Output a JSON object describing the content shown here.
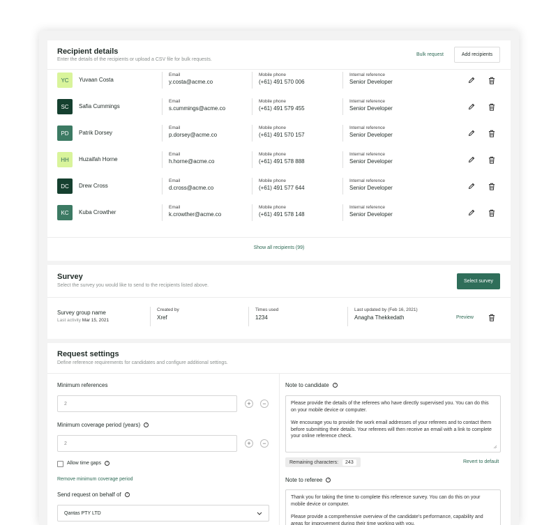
{
  "recipients": {
    "title": "Recipient details",
    "subtitle": "Enter the details of the recipients or upload a CSV file for bulk requests.",
    "bulk_request_label": "Bulk request",
    "add_recipients_label": "Add recipients",
    "email_label": "Email",
    "mobile_label": "Mobile phone",
    "reference_label": "Internal reference",
    "rows": [
      {
        "initials": "YC",
        "name": "Yuvaan Costa",
        "email": "y.costa@acme.co",
        "mobile": "(+61) 491 570 006",
        "reference": "Senior Developer",
        "avatar_color": "#d9f49b"
      },
      {
        "initials": "SC",
        "name": "Safia Cummings",
        "email": "s.cummings@acme.co",
        "mobile": "(+61) 491 579 455",
        "reference": "Senior Developer",
        "avatar_color": "#15402f"
      },
      {
        "initials": "PD",
        "name": "Patrik Dorsey",
        "email": "p.dorsey@acme.co",
        "mobile": "(+61) 491 570 157",
        "reference": "Senior Developer",
        "avatar_color": "#3c7a63"
      },
      {
        "initials": "HH",
        "name": "Huzaifah Horne",
        "email": "h.horne@acme.co",
        "mobile": "(+61) 491 578 888",
        "reference": "Senior Developer",
        "avatar_color": "#d9f49b"
      },
      {
        "initials": "DC",
        "name": "Drew Cross",
        "email": "d.cross@acme.co",
        "mobile": "(+61) 491 577 644",
        "reference": "Senior Developer",
        "avatar_color": "#15402f"
      },
      {
        "initials": "KC",
        "name": "Kuba Crowther",
        "email": "k.crowther@acme.co",
        "mobile": "(+61) 491 578 148",
        "reference": "Senior Developer",
        "avatar_color": "#3c7a63"
      }
    ],
    "show_all_label": "Show all recipients (99)"
  },
  "survey": {
    "title": "Survey",
    "subtitle": "Select the survey you would like to send to the recipients listed above.",
    "select_label": "Select survey",
    "group_name": "Survey group name",
    "last_activity_label": "Last activity",
    "last_activity": "Mar 15, 2021",
    "created_by_label": "Created by",
    "created_by": "Xref",
    "times_used_label": "Times used",
    "times_used": "1234",
    "updated_label": "Last updated by (Feb 16, 2021)",
    "updated_by": "Anagha Thekkedath",
    "preview_label": "Preview"
  },
  "request": {
    "title": "Request settings",
    "subtitle": "Define reference requirements for candidates and configure additional settings.",
    "min_refs_label": "Minimum references",
    "min_refs_value": "2",
    "min_coverage_label": "Minimum coverage period (years)",
    "min_coverage_value": "2",
    "allow_gaps_label": "Allow time gaps",
    "remove_coverage_label": "Remove minimum coverage period",
    "behalf_label": "Send request on behalf of",
    "behalf_value": "Qantas PTY LTD",
    "note_candidate_label": "Note to candidate",
    "note_candidate_p1": "Please provide the details of the referees who have directly supervised you. You can do this on your mobile device or computer.",
    "note_candidate_p2": "We encourage you to provide the work email addresses of your referees and to contact them before submitting their details. Your referees will then receive an email with a link to complete your online reference check.",
    "remaining_label": "Remaining characters:",
    "remaining_value": "243",
    "revert_label": "Revert to default",
    "note_referee_label": "Note to referee",
    "note_referee_p1": "Thank you for taking the time to complete this reference survey. You can do this on your mobile device or computer.",
    "note_referee_p2": "Please provide a comprehensive overview of the candidate's performance, capability and areas for improvement during their time working with you."
  },
  "colors": {
    "accent": "#2f6e5a",
    "avatar_light": "#d9f49b",
    "avatar_dark": "#15402f",
    "avatar_mid": "#3c7a63"
  },
  "icons": [
    "pencil-icon",
    "trash-icon",
    "help-icon",
    "plus-icon",
    "minus-icon",
    "chevron-down-icon"
  ]
}
